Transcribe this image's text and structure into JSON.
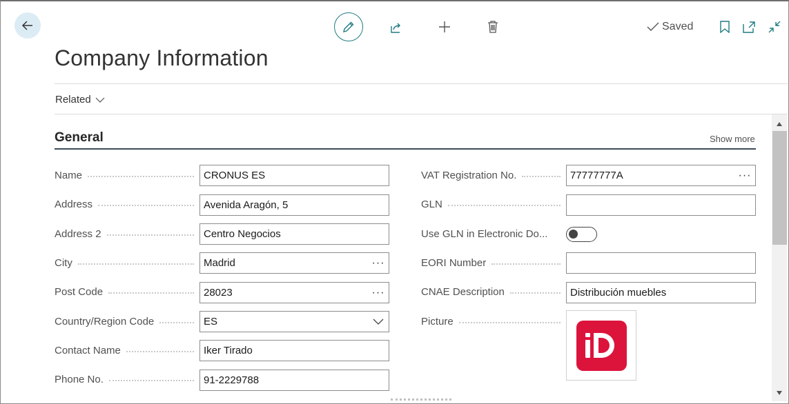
{
  "toolbar": {
    "back_icon": "arrow-left-icon",
    "edit_icon": "pencil-icon",
    "share_icon": "share-icon",
    "new_icon": "plus-icon",
    "delete_icon": "trash-icon",
    "saved_label": "Saved",
    "bookmark_icon": "bookmark-icon",
    "open_new_window_icon": "open-in-new-window-icon",
    "collapse_icon": "collapse-icon"
  },
  "page": {
    "title": "Company Information",
    "related_label": "Related"
  },
  "section": {
    "title": "General",
    "show_more": "Show more"
  },
  "left_fields": [
    {
      "label": "Name",
      "value": "CRONUS ES",
      "kind": "text"
    },
    {
      "label": "Address",
      "value": "Avenida Aragón, 5",
      "kind": "text"
    },
    {
      "label": "Address 2",
      "value": "Centro Negocios",
      "kind": "text"
    },
    {
      "label": "City",
      "value": "Madrid",
      "kind": "lookup"
    },
    {
      "label": "Post Code",
      "value": "28023",
      "kind": "lookup"
    },
    {
      "label": "Country/Region Code",
      "value": "ES",
      "kind": "dropdown"
    },
    {
      "label": "Contact Name",
      "value": "Iker Tirado",
      "kind": "text"
    },
    {
      "label": "Phone No.",
      "value": "91-2229788",
      "kind": "text"
    }
  ],
  "right_fields": [
    {
      "label": "VAT Registration No.",
      "value": "77777777A",
      "kind": "lookup"
    },
    {
      "label": "GLN",
      "value": "",
      "kind": "text"
    },
    {
      "label": "Use GLN in Electronic Do...",
      "value": "off",
      "kind": "toggle"
    },
    {
      "label": "EORI Number",
      "value": "",
      "kind": "text"
    },
    {
      "label": "CNAE Description",
      "value": "Distribución muebles",
      "kind": "text"
    },
    {
      "label": "Picture",
      "kind": "picture"
    }
  ],
  "lookup_glyph": "···",
  "colors": {
    "accent": "#1f7a80",
    "logo_red": "#dc143c",
    "back_bg": "#dcecf4"
  }
}
